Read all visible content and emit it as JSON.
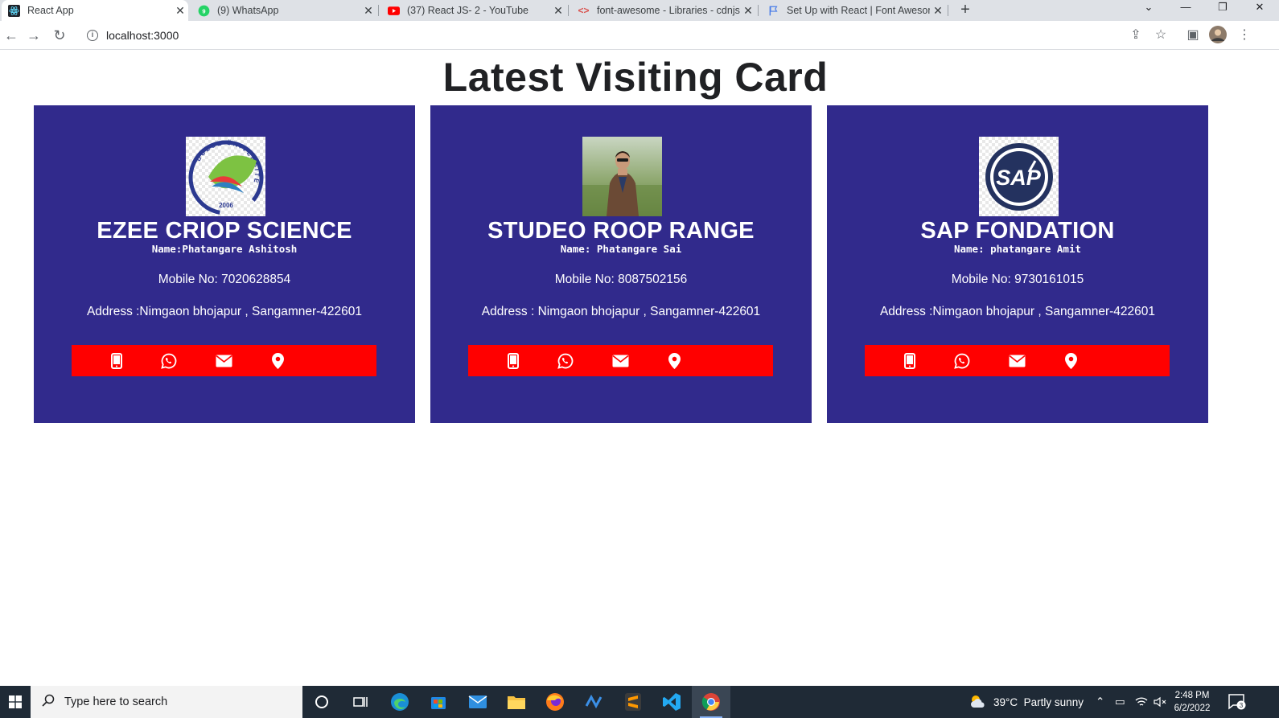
{
  "browser": {
    "tabs": [
      {
        "title": "React App",
        "icon": "react-icon",
        "active": true
      },
      {
        "title": "(9) WhatsApp",
        "icon": "whatsapp-icon",
        "active": false
      },
      {
        "title": "(37) React JS- 2 - YouTube",
        "icon": "youtube-icon",
        "active": false
      },
      {
        "title": "font-awesome - Libraries - cdnjs",
        "icon": "code-icon",
        "active": false
      },
      {
        "title": "Set Up with React | Font Awesom",
        "icon": "flag-icon",
        "active": false
      }
    ],
    "address": "localhost:3000"
  },
  "page": {
    "heading": "Latest Visiting Card",
    "cards": [
      {
        "company": "EZEE CRIOP SCIENCE",
        "name": "Name:Phatangare Ashitosh",
        "mobile": "Mobile No: 7020628854",
        "address": "Address :Nimgaon bhojapur , Sangamner-422601",
        "logo": "university-logo",
        "logo_text": "DÜZCE ÜNIVERSITESI",
        "logo_year": "2006"
      },
      {
        "company": "STUDEO ROOP RANGE",
        "name": "Name: Phatangare Sai",
        "mobile": "Mobile No: 8087502156",
        "address": "Address : Nimgaon bhojapur , Sangamner-422601",
        "logo": "person-photo"
      },
      {
        "company": "SAP FONDATION",
        "name": "Name: phatangare Amit",
        "mobile": "Mobile No: 9730161015",
        "address": "Address :Nimgaon bhojapur , Sangamner-422601",
        "logo": "sap-logo",
        "logo_text": "SAP"
      }
    ],
    "action_icons": [
      "mobile-icon",
      "whatsapp-icon",
      "envelope-icon",
      "map-marker-icon"
    ],
    "colors": {
      "card_bg": "#312a8c",
      "bar_bg": "#ff0000"
    }
  },
  "taskbar": {
    "search_placeholder": "Type here to search",
    "weather": "39°C  Partly sunny",
    "time": "2:48 PM",
    "date": "6/2/2022",
    "notification_count": "3"
  }
}
